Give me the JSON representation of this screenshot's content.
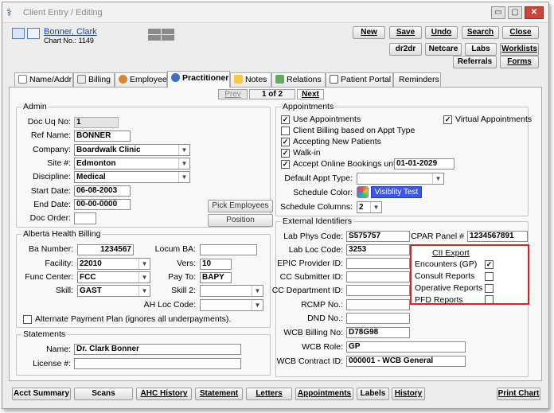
{
  "window": {
    "title": "Client Entry / Editing",
    "controls": {
      "minimize": "▭",
      "maximize": "▢",
      "close": "✕"
    }
  },
  "header": {
    "patient_name": "Bonner, Clark",
    "chart_no": "Chart No.: 1149"
  },
  "toolbar": {
    "new": "New",
    "save": "Save",
    "undo": "Undo",
    "search": "Search",
    "close": "Close",
    "dr2dr": "dr2dr",
    "netcare": "Netcare",
    "labs": "Labs",
    "worklists": "Worklists",
    "referrals": "Referrals",
    "forms": "Forms"
  },
  "tabs": [
    {
      "label": "Name/Addr",
      "icon": "id-card-icon"
    },
    {
      "label": "Billing",
      "icon": "calculator-icon"
    },
    {
      "label": "Employee",
      "icon": "people-icon"
    },
    {
      "label": "Practitioner",
      "icon": "doctor-icon"
    },
    {
      "label": "Notes",
      "icon": "notes-icon"
    },
    {
      "label": "Relations",
      "icon": "relations-icon"
    },
    {
      "label": "Patient Portal",
      "icon": "portal-icon"
    },
    {
      "label": "Reminders",
      "icon": ""
    }
  ],
  "pager": {
    "prev": "Prev",
    "status": "1 of 2",
    "next": "Next"
  },
  "admin": {
    "title": "Admin",
    "doc_uq_no": {
      "label": "Doc Uq No:",
      "value": "1"
    },
    "ref_name": {
      "label": "Ref Name:",
      "value": "BONNER"
    },
    "company": {
      "label": "Company:",
      "value": "Boardwalk Clinic"
    },
    "site": {
      "label": "Site #:",
      "value": "Edmonton"
    },
    "discipline": {
      "label": "Discipline:",
      "value": "Medical"
    },
    "start_date": {
      "label": "Start Date:",
      "value": "06-08-2003"
    },
    "end_date": {
      "label": "End Date:",
      "value": "00-00-0000"
    },
    "doc_order": {
      "label": "Doc Order:",
      "value": ""
    },
    "pick_employees": "Pick Employees",
    "position": "Position"
  },
  "ahb": {
    "title": "Alberta Health Billing",
    "ba_number": {
      "label": "Ba Number:",
      "value": "1234567"
    },
    "locum_ba": {
      "label": "Locum BA:",
      "value": ""
    },
    "facility": {
      "label": "Facility:",
      "value": "22010"
    },
    "vers": {
      "label": "Vers:",
      "value": "10"
    },
    "func_center": {
      "label": "Func Center:",
      "value": "FCC"
    },
    "pay_to": {
      "label": "Pay To:",
      "value": "BAPY"
    },
    "skill": {
      "label": "Skill:",
      "value": "GAST"
    },
    "skill2": {
      "label": "Skill 2:",
      "value": ""
    },
    "ah_loc_code": {
      "label": "AH Loc Code:",
      "value": ""
    },
    "alt_payment": "Alternate Payment Plan (ignores all underpayments)."
  },
  "statements": {
    "title": "Statements",
    "name": {
      "label": "Name:",
      "value": "Dr. Clark Bonner"
    },
    "license": {
      "label": "License #:",
      "value": ""
    }
  },
  "appointments": {
    "title": "Appointments",
    "use_appointments": "Use Appointments",
    "virtual_appointments": "Virtual Appointments",
    "client_billing": "Client Billing based on Appt Type",
    "accepting_new": "Accepting New Patients",
    "walk_in": "Walk-in",
    "accept_online": "Accept Online Bookings until",
    "online_date": "01-01-2029",
    "default_appt_type": "Default Appt Type:",
    "schedule_color": "Schedule Color:",
    "visibility_test": "Visiblity Test",
    "schedule_columns": "Schedule Columns:",
    "schedule_columns_value": "2"
  },
  "external": {
    "title": "External Identifiers",
    "lab_phys_code": {
      "label": "Lab Phys Code:",
      "value": "S575757"
    },
    "cpar_panel": {
      "label": "CPAR Panel #",
      "value": "1234567891"
    },
    "lab_loc_code": {
      "label": "Lab Loc Code:",
      "value": "3253"
    },
    "epic_provider": {
      "label": "EPIC Provider ID:",
      "value": ""
    },
    "cc_submitter": {
      "label": "CC Submitter ID:",
      "value": ""
    },
    "cc_department": {
      "label": "CC Department ID:",
      "value": ""
    },
    "rcmp_no": {
      "label": "RCMP No.:",
      "value": ""
    },
    "dnd_no": {
      "label": "DND No.:",
      "value": ""
    },
    "wcb_billing": {
      "label": "WCB Billing No:",
      "value": "D78G98"
    },
    "wcb_role": {
      "label": "WCB Role:",
      "value": "GP"
    },
    "wcb_contract": {
      "label": "WCB Contract ID:",
      "value": "000001 - WCB General"
    }
  },
  "cii_export": {
    "title": "CII Export",
    "items": [
      {
        "label": "Encounters (GP)",
        "checked": "✓"
      },
      {
        "label": "Consult Reports",
        "checked": ""
      },
      {
        "label": "Operative Reports",
        "checked": ""
      },
      {
        "label": "PFD Reports",
        "checked": ""
      }
    ]
  },
  "bottom": {
    "acct_summary": "Acct Summary",
    "scans": "Scans",
    "ahc_history": "AHC History",
    "statement": "Statement",
    "letters": "Letters",
    "appointments": "Appointments",
    "labels": "Labels",
    "history": "History",
    "print_chart": "Print Chart"
  },
  "icons": {
    "check": "✓",
    "dropdown": "▼",
    "app": "⚕"
  }
}
